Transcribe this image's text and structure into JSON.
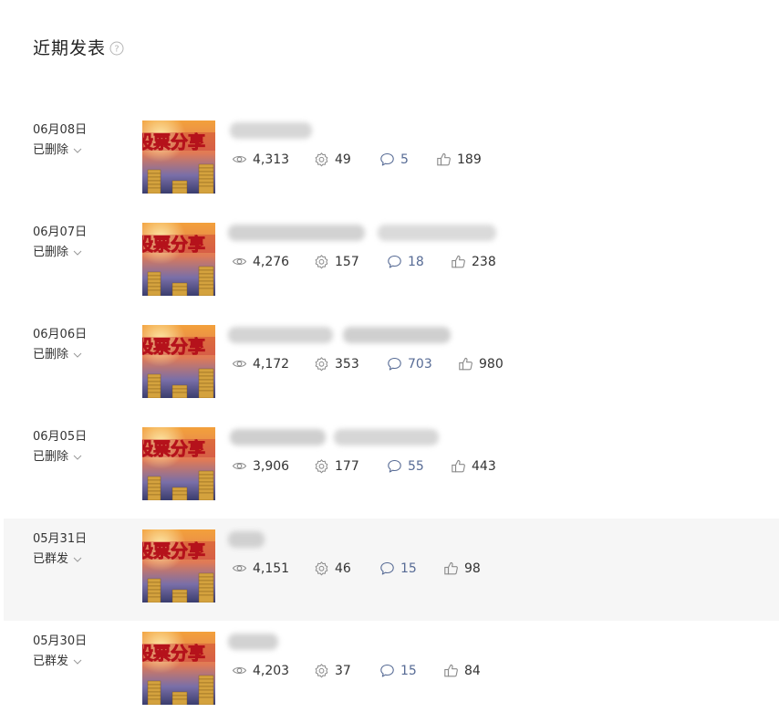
{
  "header": {
    "title": "近期发表",
    "help_icon": "question-circle-icon"
  },
  "colors": {
    "comment": "#576b95",
    "highlight_row": "#f6f6f6"
  },
  "items": [
    {
      "date": "06月08日",
      "status": "已删除",
      "views": "4,313",
      "shares": "49",
      "comments": "5",
      "likes": "189"
    },
    {
      "date": "06月07日",
      "status": "已删除",
      "views": "4,276",
      "shares": "157",
      "comments": "18",
      "likes": "238"
    },
    {
      "date": "06月06日",
      "status": "已删除",
      "views": "4,172",
      "shares": "353",
      "comments": "703",
      "likes": "980"
    },
    {
      "date": "06月05日",
      "status": "已删除",
      "views": "3,906",
      "shares": "177",
      "comments": "55",
      "likes": "443"
    },
    {
      "date": "05月31日",
      "status": "已群发",
      "views": "4,151",
      "shares": "46",
      "comments": "15",
      "likes": "98"
    },
    {
      "date": "05月30日",
      "status": "已群发",
      "views": "4,203",
      "shares": "37",
      "comments": "15",
      "likes": "84"
    }
  ]
}
